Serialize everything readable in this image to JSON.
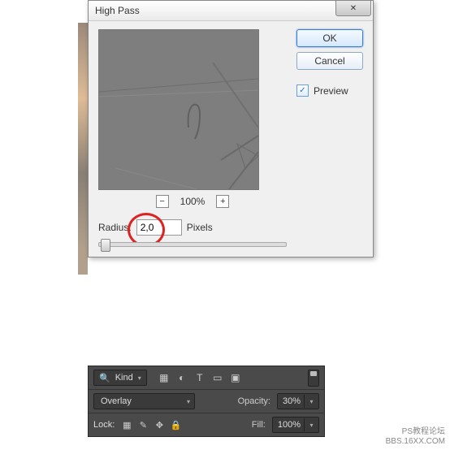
{
  "dialog": {
    "title": "High Pass",
    "close_glyph": "✕",
    "ok_label": "OK",
    "cancel_label": "Cancel",
    "preview_label": "Preview",
    "preview_checked": true,
    "zoom": {
      "minus": "−",
      "plus": "+",
      "value": "100%"
    },
    "radius_label": "Radius:",
    "radius_value": "2,0",
    "radius_unit": "Pixels"
  },
  "layers": {
    "kind_label": "Kind",
    "filter_icons": {
      "image": "▦",
      "adjust": "◐",
      "type": "T",
      "shape": "▭",
      "smart": "▣"
    },
    "blend_mode": "Overlay",
    "opacity_label": "Opacity:",
    "opacity_value": "30%",
    "lock_label": "Lock:",
    "lock_icons": {
      "transparent": "▦",
      "brush": "✎",
      "move": "✥",
      "all": "🔒"
    },
    "fill_label": "Fill:",
    "fill_value": "100%"
  },
  "watermark": {
    "line1": "PS教程论坛",
    "line2": "BBS.16XX.COM"
  }
}
